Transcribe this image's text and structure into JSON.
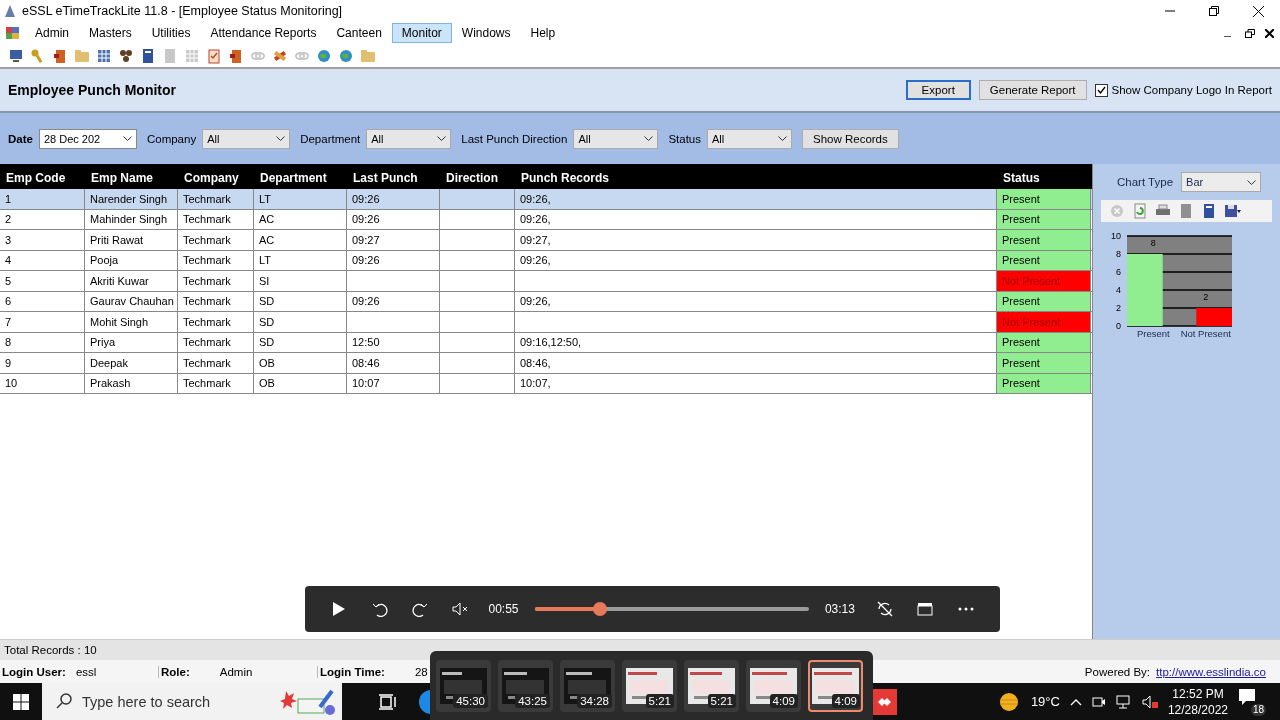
{
  "window": {
    "title": "eSSL eTimeTrackLite 11.8 - [Employee Status Monitoring]"
  },
  "menu": [
    {
      "label": "Admin",
      "selected": false
    },
    {
      "label": "Masters",
      "selected": false
    },
    {
      "label": "Utilities",
      "selected": false
    },
    {
      "label": "Attendance Reports",
      "selected": false
    },
    {
      "label": "Canteen",
      "selected": false
    },
    {
      "label": "Monitor",
      "selected": true
    },
    {
      "label": "Windows",
      "selected": false
    },
    {
      "label": "Help",
      "selected": false
    }
  ],
  "toolbar": [
    {
      "kind": "computer",
      "disabled": false
    },
    {
      "kind": "key",
      "disabled": false
    },
    {
      "kind": "door",
      "disabled": false
    },
    {
      "kind": "folder",
      "disabled": false
    },
    {
      "kind": "grid",
      "disabled": false
    },
    {
      "kind": "people",
      "disabled": false
    },
    {
      "kind": "book",
      "disabled": false
    },
    {
      "kind": "page",
      "disabled": true
    },
    {
      "kind": "grid",
      "disabled": true
    },
    {
      "kind": "clipboard",
      "disabled": false
    },
    {
      "kind": "door",
      "disabled": false
    },
    {
      "kind": "link",
      "disabled": true
    },
    {
      "kind": "tools",
      "disabled": false
    },
    {
      "kind": "link",
      "disabled": true
    },
    {
      "kind": "globe",
      "disabled": false
    },
    {
      "kind": "globe",
      "disabled": false
    },
    {
      "kind": "folder",
      "disabled": false
    }
  ],
  "panel": {
    "title": "Employee Punch Monitor",
    "export_button": "Export",
    "report_button": "Generate Report",
    "logo_checkbox": {
      "label": "Show Company Logo In Report",
      "checked": true
    }
  },
  "filters": {
    "date": {
      "label": "Date",
      "value": "28 Dec 202"
    },
    "selects": [
      {
        "label": "Company",
        "value": "All"
      },
      {
        "label": "Department",
        "value": "All"
      },
      {
        "label": "Last Punch Direction",
        "value": "All"
      },
      {
        "label": "Status",
        "value": "All"
      }
    ],
    "button": "Show Records"
  },
  "table": {
    "columns": [
      "Emp Code",
      "Emp Name",
      "Company",
      "Department",
      "Last Punch",
      "Direction",
      "Punch Records",
      "Status"
    ],
    "rows": [
      {
        "emp_code": "1",
        "emp_name": "Narender Singh",
        "company": "Techmark",
        "department": "LT",
        "last_punch": "09:26",
        "punch_records": "09:26,",
        "status": {
          "text": "Present",
          "color": "#90ee90"
        },
        "selected": true
      },
      {
        "emp_code": "2",
        "emp_name": "Mahinder Singh",
        "company": "Techmark",
        "department": "AC",
        "last_punch": "09:26",
        "punch_records": "09:26,",
        "status": {
          "text": "Present",
          "color": "#90ee90"
        },
        "selected": false
      },
      {
        "emp_code": "3",
        "emp_name": "Priti Rawat",
        "company": "Techmark",
        "department": "AC",
        "last_punch": "09:27",
        "punch_records": "09:27,",
        "status": {
          "text": "Present",
          "color": "#90ee90"
        },
        "selected": false
      },
      {
        "emp_code": "4",
        "emp_name": "Pooja",
        "company": "Techmark",
        "department": "LT",
        "last_punch": "09:26",
        "punch_records": "09:26,",
        "status": {
          "text": "Present",
          "color": "#90ee90"
        },
        "selected": false
      },
      {
        "emp_code": "5",
        "emp_name": "Akriti Kuwar",
        "company": "Techmark",
        "department": "SI",
        "status": {
          "text": "Not Present",
          "color": "#ff0000"
        },
        "selected": false
      },
      {
        "emp_code": "6",
        "emp_name": "Gaurav Chauhan",
        "company": "Techmark",
        "department": "SD",
        "last_punch": "09:26",
        "punch_records": "09:26,",
        "status": {
          "text": "Present",
          "color": "#90ee90"
        },
        "selected": false
      },
      {
        "emp_code": "7",
        "emp_name": "Mohit Singh",
        "company": "Techmark",
        "department": "SD",
        "status": {
          "text": "Not Present",
          "color": "#ff0000"
        },
        "selected": false
      },
      {
        "emp_code": "8",
        "emp_name": "Priya",
        "company": "Techmark",
        "department": "SD",
        "last_punch": "12:50",
        "punch_records": "09:16,12:50,",
        "status": {
          "text": "Present",
          "color": "#90ee90"
        },
        "selected": false
      },
      {
        "emp_code": "9",
        "emp_name": "Deepak",
        "company": "Techmark",
        "department": "OB",
        "last_punch": "08:46",
        "punch_records": "08:46,",
        "status": {
          "text": "Present",
          "color": "#90ee90"
        },
        "selected": false
      },
      {
        "emp_code": "10",
        "emp_name": "Prakash",
        "company": "Techmark",
        "department": "OB",
        "last_punch": "10:07",
        "punch_records": "10:07,",
        "status": {
          "text": "Present",
          "color": "#90ee90"
        },
        "selected": false
      }
    ]
  },
  "chart_panel": {
    "chart_type": {
      "label": "Chart Type",
      "value": "Bar"
    },
    "toolbar": [
      {
        "kind": "stop",
        "disabled": true
      },
      {
        "kind": "refresh",
        "disabled": false
      },
      {
        "kind": "printer",
        "disabled": false
      },
      {
        "kind": "page",
        "disabled": false
      },
      {
        "kind": "book",
        "disabled": false
      },
      {
        "kind": "save",
        "disabled": false
      }
    ],
    "chart_data": {
      "type": "bar",
      "categories": [
        "Present",
        "Not Present"
      ],
      "values": [
        8,
        2
      ],
      "colors": [
        "#90ee90",
        "#ff0000"
      ],
      "ylim": [
        0,
        10
      ],
      "yticks": [
        0,
        2,
        4,
        6,
        8,
        10
      ],
      "grid": true,
      "data_labels": true
    }
  },
  "footer": {
    "total_records": "Total Records :  10",
    "login": [
      {
        "label": "Login User:",
        "value": "essl"
      },
      {
        "label": "Role:",
        "value": "Admin"
      },
      {
        "label": "Login Time:",
        "value": "28"
      }
    ],
    "powered_by": {
      "label": "Powered By:",
      "link": "ttp://www.esslindia.co"
    }
  },
  "player": {
    "current": "00:55",
    "duration": "03:13",
    "level": 0.24
  },
  "thumbnails": [
    {
      "duration": "45:30",
      "selected": false
    },
    {
      "duration": "43:25",
      "selected": false
    },
    {
      "duration": "34:28",
      "selected": false
    },
    {
      "duration": "5:21",
      "selected": false
    },
    {
      "duration": "5:21",
      "selected": false
    },
    {
      "duration": "4:09",
      "selected": false
    },
    {
      "duration": "4:09",
      "selected": true
    }
  ],
  "taskbar": {
    "search_placeholder": "Type here to search",
    "temperature": "19°C",
    "time": "12:52 PM",
    "date": "12/28/2022",
    "notifications": "18"
  }
}
